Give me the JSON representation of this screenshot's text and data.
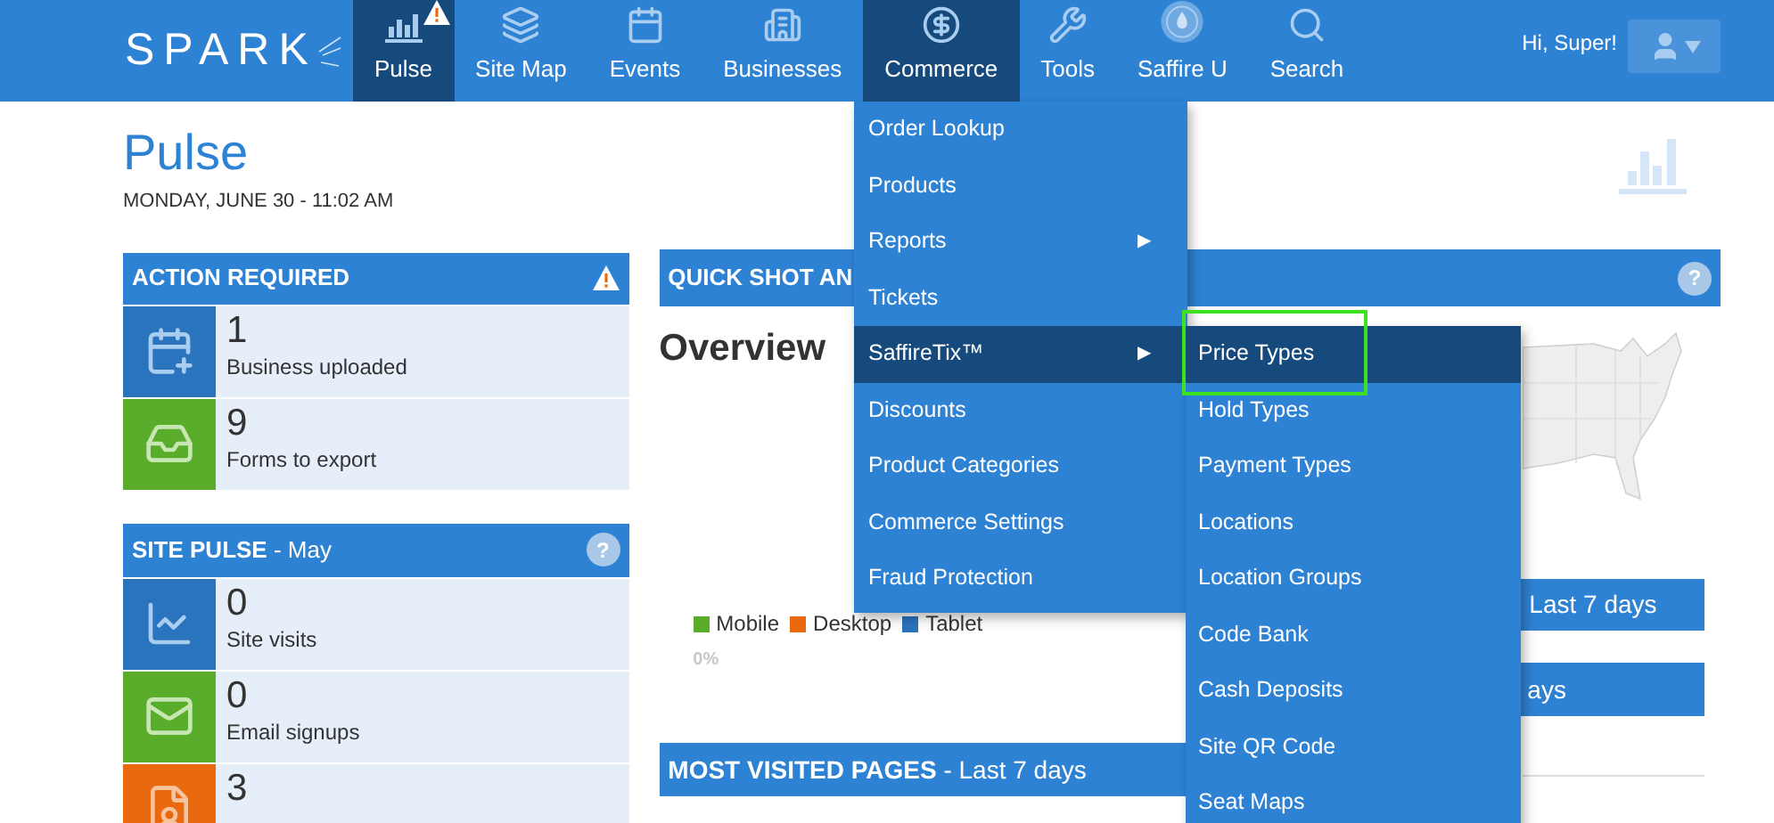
{
  "header": {
    "logo": "SPARK",
    "nav": [
      {
        "label": "Pulse",
        "selected": true,
        "alert": true
      },
      {
        "label": "Site Map",
        "selected": false,
        "alert": false
      },
      {
        "label": "Events",
        "selected": false,
        "alert": false
      },
      {
        "label": "Businesses",
        "selected": false,
        "alert": false
      },
      {
        "label": "Commerce",
        "selected": true,
        "alert": false
      },
      {
        "label": "Tools",
        "selected": false,
        "alert": false
      },
      {
        "label": "Saffire U",
        "selected": false,
        "alert": false
      },
      {
        "label": "Search",
        "selected": false,
        "alert": false
      }
    ],
    "greeting": "Hi, Super!"
  },
  "page": {
    "title": "Pulse",
    "date": "MONDAY, JUNE 30 - 11:02 AM"
  },
  "action_required": {
    "title": "ACTION REQUIRED",
    "rows": [
      {
        "count": "1",
        "label": "Business uploaded",
        "color": "#2a73bd"
      },
      {
        "count": "9",
        "label": "Forms to export",
        "color": "#5aad2a"
      }
    ]
  },
  "site_pulse": {
    "title": "SITE PULSE",
    "subtitle": "- May",
    "help": "?",
    "rows": [
      {
        "count": "0",
        "label": "Site visits",
        "color": "#2a73bd"
      },
      {
        "count": "0",
        "label": "Email signups",
        "color": "#5aad2a"
      },
      {
        "count": "3",
        "color": "#e8690e"
      }
    ]
  },
  "quick_shot": {
    "title": "QUICK SHOT AN",
    "help": "?",
    "overview": "Overview",
    "legend": [
      {
        "label": "Mobile",
        "color": "#5aad2a"
      },
      {
        "label": "Desktop",
        "color": "#e8690e"
      },
      {
        "label": "Tablet",
        "color": "#2a73bd"
      }
    ],
    "percent": "0%"
  },
  "bar_1": {
    "text": "Last 7 days"
  },
  "bar_2": {
    "text": "ays"
  },
  "most_visited": {
    "title": "MOST VISITED PAGES",
    "subtitle": "- Last 7 days"
  },
  "commerce_menu": [
    {
      "label": "Order Lookup",
      "selected": false
    },
    {
      "label": "Products",
      "selected": false
    },
    {
      "label": "Reports",
      "selected": false,
      "arrow": "▶"
    },
    {
      "label": "Tickets",
      "selected": false
    },
    {
      "label": "SaffireTix™",
      "selected": true,
      "arrow": "▶"
    },
    {
      "label": "Discounts",
      "selected": false
    },
    {
      "label": "Product Categories",
      "selected": false
    },
    {
      "label": "Commerce Settings",
      "selected": false
    },
    {
      "label": "Fraud Protection",
      "selected": false
    }
  ],
  "saffiretix_menu": [
    {
      "label": "Price Types",
      "selected": true
    },
    {
      "label": "Hold Types",
      "selected": false
    },
    {
      "label": "Payment Types",
      "selected": false
    },
    {
      "label": "Locations",
      "selected": false
    },
    {
      "label": "Location Groups",
      "selected": false
    },
    {
      "label": "Code Bank",
      "selected": false
    },
    {
      "label": "Cash Deposits",
      "selected": false
    },
    {
      "label": "Site QR Code",
      "selected": false
    },
    {
      "label": "Seat Maps",
      "selected": false
    }
  ]
}
